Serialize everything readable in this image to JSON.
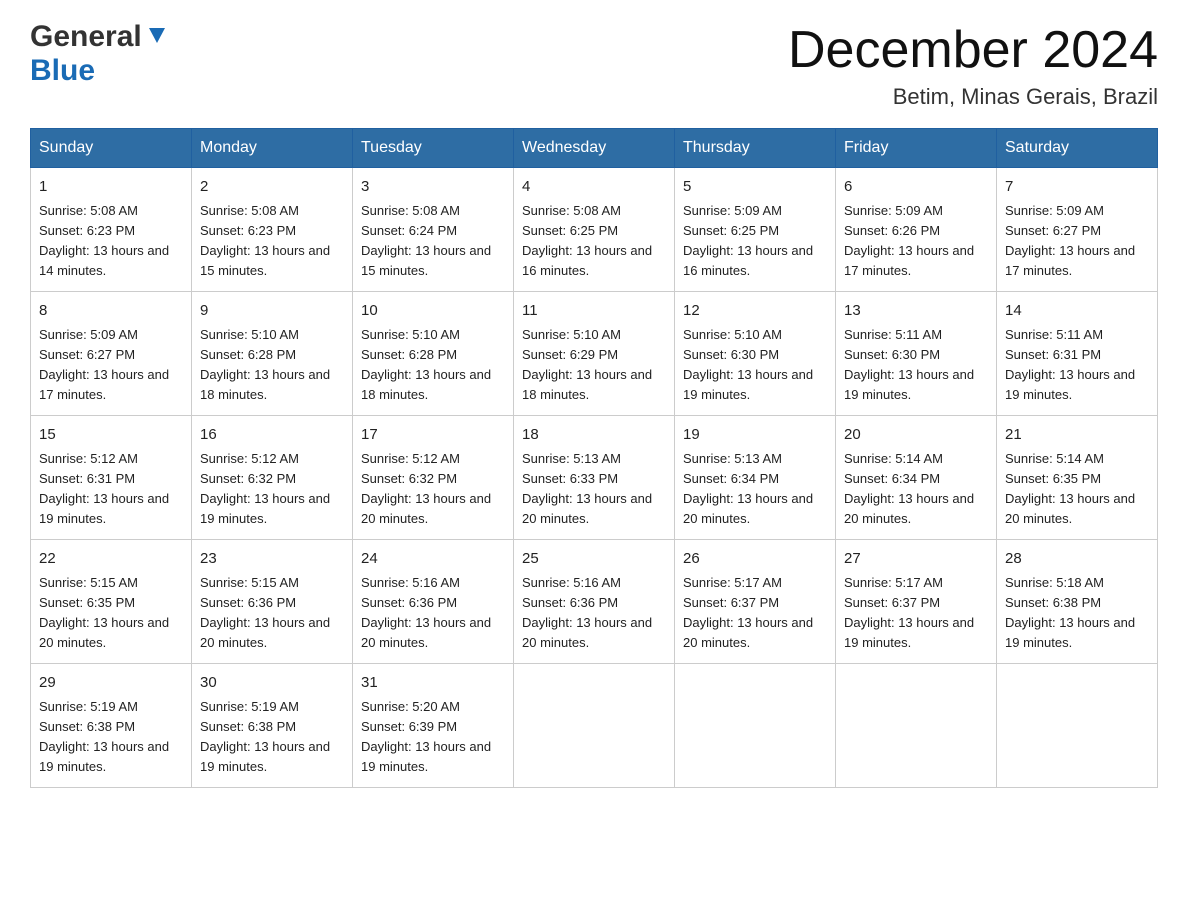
{
  "header": {
    "logo_general": "General",
    "logo_blue": "Blue",
    "month_title": "December 2024",
    "location": "Betim, Minas Gerais, Brazil"
  },
  "days_of_week": [
    "Sunday",
    "Monday",
    "Tuesday",
    "Wednesday",
    "Thursday",
    "Friday",
    "Saturday"
  ],
  "weeks": [
    [
      {
        "day": "1",
        "sunrise": "5:08 AM",
        "sunset": "6:23 PM",
        "daylight": "13 hours and 14 minutes."
      },
      {
        "day": "2",
        "sunrise": "5:08 AM",
        "sunset": "6:23 PM",
        "daylight": "13 hours and 15 minutes."
      },
      {
        "day": "3",
        "sunrise": "5:08 AM",
        "sunset": "6:24 PM",
        "daylight": "13 hours and 15 minutes."
      },
      {
        "day": "4",
        "sunrise": "5:08 AM",
        "sunset": "6:25 PM",
        "daylight": "13 hours and 16 minutes."
      },
      {
        "day": "5",
        "sunrise": "5:09 AM",
        "sunset": "6:25 PM",
        "daylight": "13 hours and 16 minutes."
      },
      {
        "day": "6",
        "sunrise": "5:09 AM",
        "sunset": "6:26 PM",
        "daylight": "13 hours and 17 minutes."
      },
      {
        "day": "7",
        "sunrise": "5:09 AM",
        "sunset": "6:27 PM",
        "daylight": "13 hours and 17 minutes."
      }
    ],
    [
      {
        "day": "8",
        "sunrise": "5:09 AM",
        "sunset": "6:27 PM",
        "daylight": "13 hours and 17 minutes."
      },
      {
        "day": "9",
        "sunrise": "5:10 AM",
        "sunset": "6:28 PM",
        "daylight": "13 hours and 18 minutes."
      },
      {
        "day": "10",
        "sunrise": "5:10 AM",
        "sunset": "6:28 PM",
        "daylight": "13 hours and 18 minutes."
      },
      {
        "day": "11",
        "sunrise": "5:10 AM",
        "sunset": "6:29 PM",
        "daylight": "13 hours and 18 minutes."
      },
      {
        "day": "12",
        "sunrise": "5:10 AM",
        "sunset": "6:30 PM",
        "daylight": "13 hours and 19 minutes."
      },
      {
        "day": "13",
        "sunrise": "5:11 AM",
        "sunset": "6:30 PM",
        "daylight": "13 hours and 19 minutes."
      },
      {
        "day": "14",
        "sunrise": "5:11 AM",
        "sunset": "6:31 PM",
        "daylight": "13 hours and 19 minutes."
      }
    ],
    [
      {
        "day": "15",
        "sunrise": "5:12 AM",
        "sunset": "6:31 PM",
        "daylight": "13 hours and 19 minutes."
      },
      {
        "day": "16",
        "sunrise": "5:12 AM",
        "sunset": "6:32 PM",
        "daylight": "13 hours and 19 minutes."
      },
      {
        "day": "17",
        "sunrise": "5:12 AM",
        "sunset": "6:32 PM",
        "daylight": "13 hours and 20 minutes."
      },
      {
        "day": "18",
        "sunrise": "5:13 AM",
        "sunset": "6:33 PM",
        "daylight": "13 hours and 20 minutes."
      },
      {
        "day": "19",
        "sunrise": "5:13 AM",
        "sunset": "6:34 PM",
        "daylight": "13 hours and 20 minutes."
      },
      {
        "day": "20",
        "sunrise": "5:14 AM",
        "sunset": "6:34 PM",
        "daylight": "13 hours and 20 minutes."
      },
      {
        "day": "21",
        "sunrise": "5:14 AM",
        "sunset": "6:35 PM",
        "daylight": "13 hours and 20 minutes."
      }
    ],
    [
      {
        "day": "22",
        "sunrise": "5:15 AM",
        "sunset": "6:35 PM",
        "daylight": "13 hours and 20 minutes."
      },
      {
        "day": "23",
        "sunrise": "5:15 AM",
        "sunset": "6:36 PM",
        "daylight": "13 hours and 20 minutes."
      },
      {
        "day": "24",
        "sunrise": "5:16 AM",
        "sunset": "6:36 PM",
        "daylight": "13 hours and 20 minutes."
      },
      {
        "day": "25",
        "sunrise": "5:16 AM",
        "sunset": "6:36 PM",
        "daylight": "13 hours and 20 minutes."
      },
      {
        "day": "26",
        "sunrise": "5:17 AM",
        "sunset": "6:37 PM",
        "daylight": "13 hours and 20 minutes."
      },
      {
        "day": "27",
        "sunrise": "5:17 AM",
        "sunset": "6:37 PM",
        "daylight": "13 hours and 19 minutes."
      },
      {
        "day": "28",
        "sunrise": "5:18 AM",
        "sunset": "6:38 PM",
        "daylight": "13 hours and 19 minutes."
      }
    ],
    [
      {
        "day": "29",
        "sunrise": "5:19 AM",
        "sunset": "6:38 PM",
        "daylight": "13 hours and 19 minutes."
      },
      {
        "day": "30",
        "sunrise": "5:19 AM",
        "sunset": "6:38 PM",
        "daylight": "13 hours and 19 minutes."
      },
      {
        "day": "31",
        "sunrise": "5:20 AM",
        "sunset": "6:39 PM",
        "daylight": "13 hours and 19 minutes."
      },
      null,
      null,
      null,
      null
    ]
  ],
  "labels": {
    "sunrise_prefix": "Sunrise: ",
    "sunset_prefix": "Sunset: ",
    "daylight_prefix": "Daylight: "
  }
}
